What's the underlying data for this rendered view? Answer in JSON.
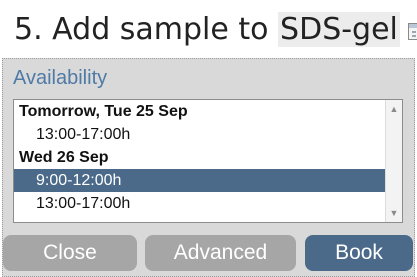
{
  "step": {
    "title_prefix": "5. Add sample to ",
    "title_target": "SDS-gel"
  },
  "icons": {
    "calendar": "calendar-icon"
  },
  "availability": {
    "label": "Availability",
    "rows": [
      {
        "text": "Tomorrow, Tue 25 Sep",
        "kind": "date-header"
      },
      {
        "text": "13:00-17:00h",
        "kind": "slot"
      },
      {
        "text": "Wed 26 Sep",
        "kind": "date-header"
      },
      {
        "text": "9:00-12:00h",
        "kind": "slot",
        "selected": true
      },
      {
        "text": "13:00-17:00h",
        "kind": "slot"
      }
    ],
    "scroll_up": "▲",
    "scroll_down": "▼"
  },
  "buttons": {
    "close": "Close",
    "advanced": "Advanced",
    "book": "Book"
  },
  "colors": {
    "accent": "#4b6a8a",
    "label_blue": "#4f7aa6",
    "panel_bg": "#d9d9d9",
    "button_gray": "#a6a6a6"
  }
}
